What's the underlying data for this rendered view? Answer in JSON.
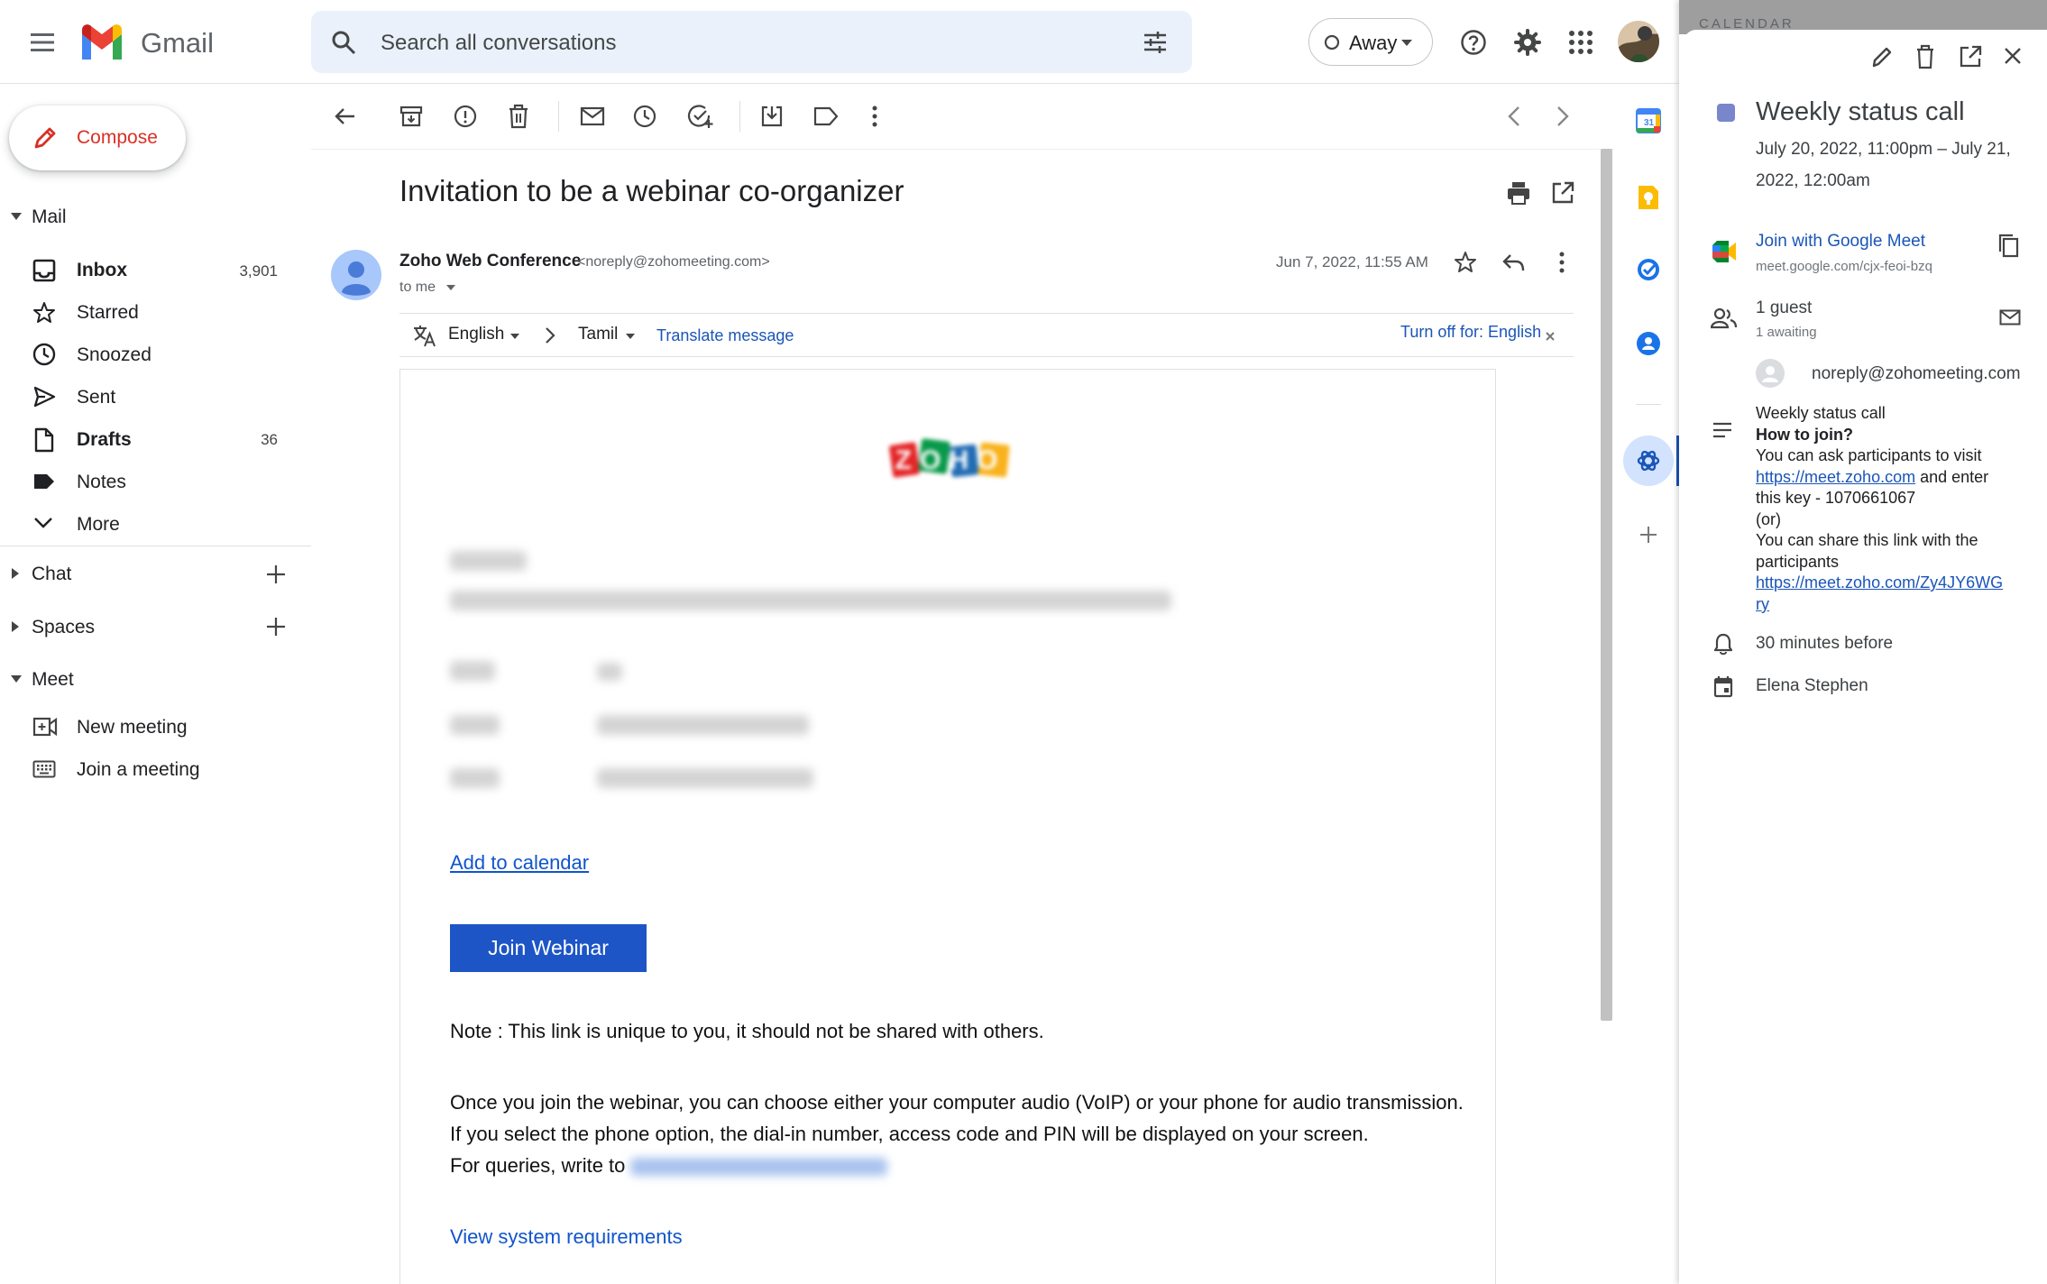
{
  "app": {
    "name": "Gmail"
  },
  "search": {
    "placeholder": "Search all conversations"
  },
  "status": {
    "label": "Away"
  },
  "compose": {
    "label": "Compose"
  },
  "nav": {
    "mail_header": "Mail",
    "items": [
      {
        "label": "Inbox",
        "count": "3,901",
        "bold": true
      },
      {
        "label": "Starred",
        "count": ""
      },
      {
        "label": "Snoozed",
        "count": ""
      },
      {
        "label": "Sent",
        "count": ""
      },
      {
        "label": "Drafts",
        "count": "36",
        "bold": true
      },
      {
        "label": "Notes",
        "count": ""
      },
      {
        "label": "More",
        "count": ""
      }
    ],
    "chat_header": "Chat",
    "spaces_header": "Spaces",
    "meet_header": "Meet",
    "meet_items": [
      {
        "label": "New meeting"
      },
      {
        "label": "Join a meeting"
      }
    ]
  },
  "email": {
    "subject": "Invitation to be a webinar co-organizer",
    "sender_name": "Zoho Web Conference",
    "sender_email": "<noreply@zohomeeting.com>",
    "to": "to me",
    "date": "Jun 7, 2022, 11:55 AM",
    "translate": {
      "from": "English",
      "to": "Tamil",
      "action": "Translate message",
      "turn_off": "Turn off for: English"
    },
    "body": {
      "logo_text": "ZOHO",
      "add_to_calendar": "Add to calendar",
      "join_button": "Join Webinar",
      "note": "Note : This link is unique to you, it should not be shared with others.",
      "para1": "Once you join the webinar, you can choose either your computer audio (VoIP) or your phone for audio transmission.",
      "para2": "If you select the phone option, the dial-in number, access code and PIN will be displayed on your screen.",
      "queries": "For queries, write to",
      "system_req": "View system requirements"
    }
  },
  "calendar": {
    "section_label": "CALENDAR",
    "event_color": "#7986cb",
    "title": "Weekly status call",
    "datetime_line1": "July 20, 2022, 11:00pm – July 21,",
    "datetime_line2": "2022, 12:00am",
    "meet_link_label": "Join with Google Meet",
    "meet_url": "meet.google.com/cjx-feoi-bzq",
    "guests": "1 guest",
    "guests_awaiting": "1 awaiting",
    "guest_email": "noreply@zohomeeting.com",
    "description": {
      "title": "Weekly status call",
      "how": "How to join?",
      "line1": "You can ask participants to visit",
      "link1": "https://meet.zoho.com",
      "line2_suffix": " and enter",
      "line3": "this key - 1070661067",
      "line4": "(or)",
      "line5": "You can share this link with the",
      "line6": "participants",
      "link2a": "https://meet.zoho.com/Zy4JY6WG",
      "link2b": "ry"
    },
    "reminder": "30 minutes before",
    "organizer": "Elena Stephen"
  }
}
